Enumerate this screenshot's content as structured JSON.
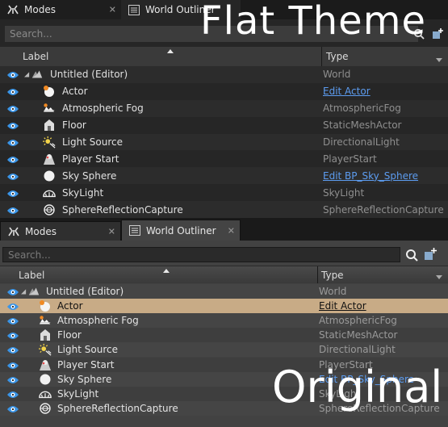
{
  "colors": {
    "link": "#5c9cf0",
    "selected_row": "#c8ab86",
    "eye": "#3a95e8"
  },
  "flat_panel": {
    "overlay_title": "Flat Theme",
    "tabs": [
      {
        "label": "Modes",
        "icon": "modes-icon"
      },
      {
        "label": "World Outliner",
        "icon": "world-outliner-icon"
      }
    ],
    "search_placeholder": "Search...",
    "columns": {
      "label": "Label",
      "type": "Type"
    },
    "rows": [
      {
        "label": "Untitled (Editor)",
        "type": "World",
        "type_link": false,
        "icon": "world-icon",
        "root": true
      },
      {
        "label": "Actor",
        "type": "Edit Actor",
        "type_link": true,
        "icon": "actor-icon"
      },
      {
        "label": "Atmospheric Fog",
        "type": "AtmosphericFog",
        "type_link": false,
        "icon": "fog-icon"
      },
      {
        "label": "Floor",
        "type": "StaticMeshActor",
        "type_link": false,
        "icon": "static-mesh-icon"
      },
      {
        "label": "Light Source",
        "type": "DirectionalLight",
        "type_link": false,
        "icon": "directional-light-icon"
      },
      {
        "label": "Player Start",
        "type": "PlayerStart",
        "type_link": false,
        "icon": "player-start-icon"
      },
      {
        "label": "Sky Sphere",
        "type": "Edit BP_Sky_Sphere",
        "type_link": true,
        "icon": "sky-sphere-icon"
      },
      {
        "label": "SkyLight",
        "type": "SkyLight",
        "type_link": false,
        "icon": "skylight-icon"
      },
      {
        "label": "SphereReflectionCapture",
        "type": "SphereReflectionCapture",
        "type_link": false,
        "icon": "reflection-capture-icon"
      }
    ]
  },
  "original_panel": {
    "overlay_title": "Original",
    "tabs": [
      {
        "label": "Modes",
        "icon": "modes-icon"
      },
      {
        "label": "World Outliner",
        "icon": "world-outliner-icon"
      }
    ],
    "search_placeholder": "Search...",
    "columns": {
      "label": "Label",
      "type": "Type"
    },
    "rows": [
      {
        "label": "Untitled (Editor)",
        "type": "World",
        "type_link": false,
        "icon": "world-icon",
        "root": true
      },
      {
        "label": "Actor",
        "type": "Edit Actor",
        "type_link": true,
        "icon": "actor-icon",
        "selected": true
      },
      {
        "label": "Atmospheric Fog",
        "type": "AtmosphericFog",
        "type_link": false,
        "icon": "fog-icon"
      },
      {
        "label": "Floor",
        "type": "StaticMeshActor",
        "type_link": false,
        "icon": "static-mesh-icon"
      },
      {
        "label": "Light Source",
        "type": "DirectionalLight",
        "type_link": false,
        "icon": "directional-light-icon"
      },
      {
        "label": "Player Start",
        "type": "PlayerStart",
        "type_link": false,
        "icon": "player-start-icon"
      },
      {
        "label": "Sky Sphere",
        "type": "Edit BP_Sky_Sphere",
        "type_link": true,
        "icon": "sky-sphere-icon"
      },
      {
        "label": "SkyLight",
        "type": "SkyLight",
        "type_link": false,
        "icon": "skylight-icon"
      },
      {
        "label": "SphereReflectionCapture",
        "type": "SphereReflectionCapture",
        "type_link": false,
        "icon": "reflection-capture-icon"
      }
    ]
  }
}
